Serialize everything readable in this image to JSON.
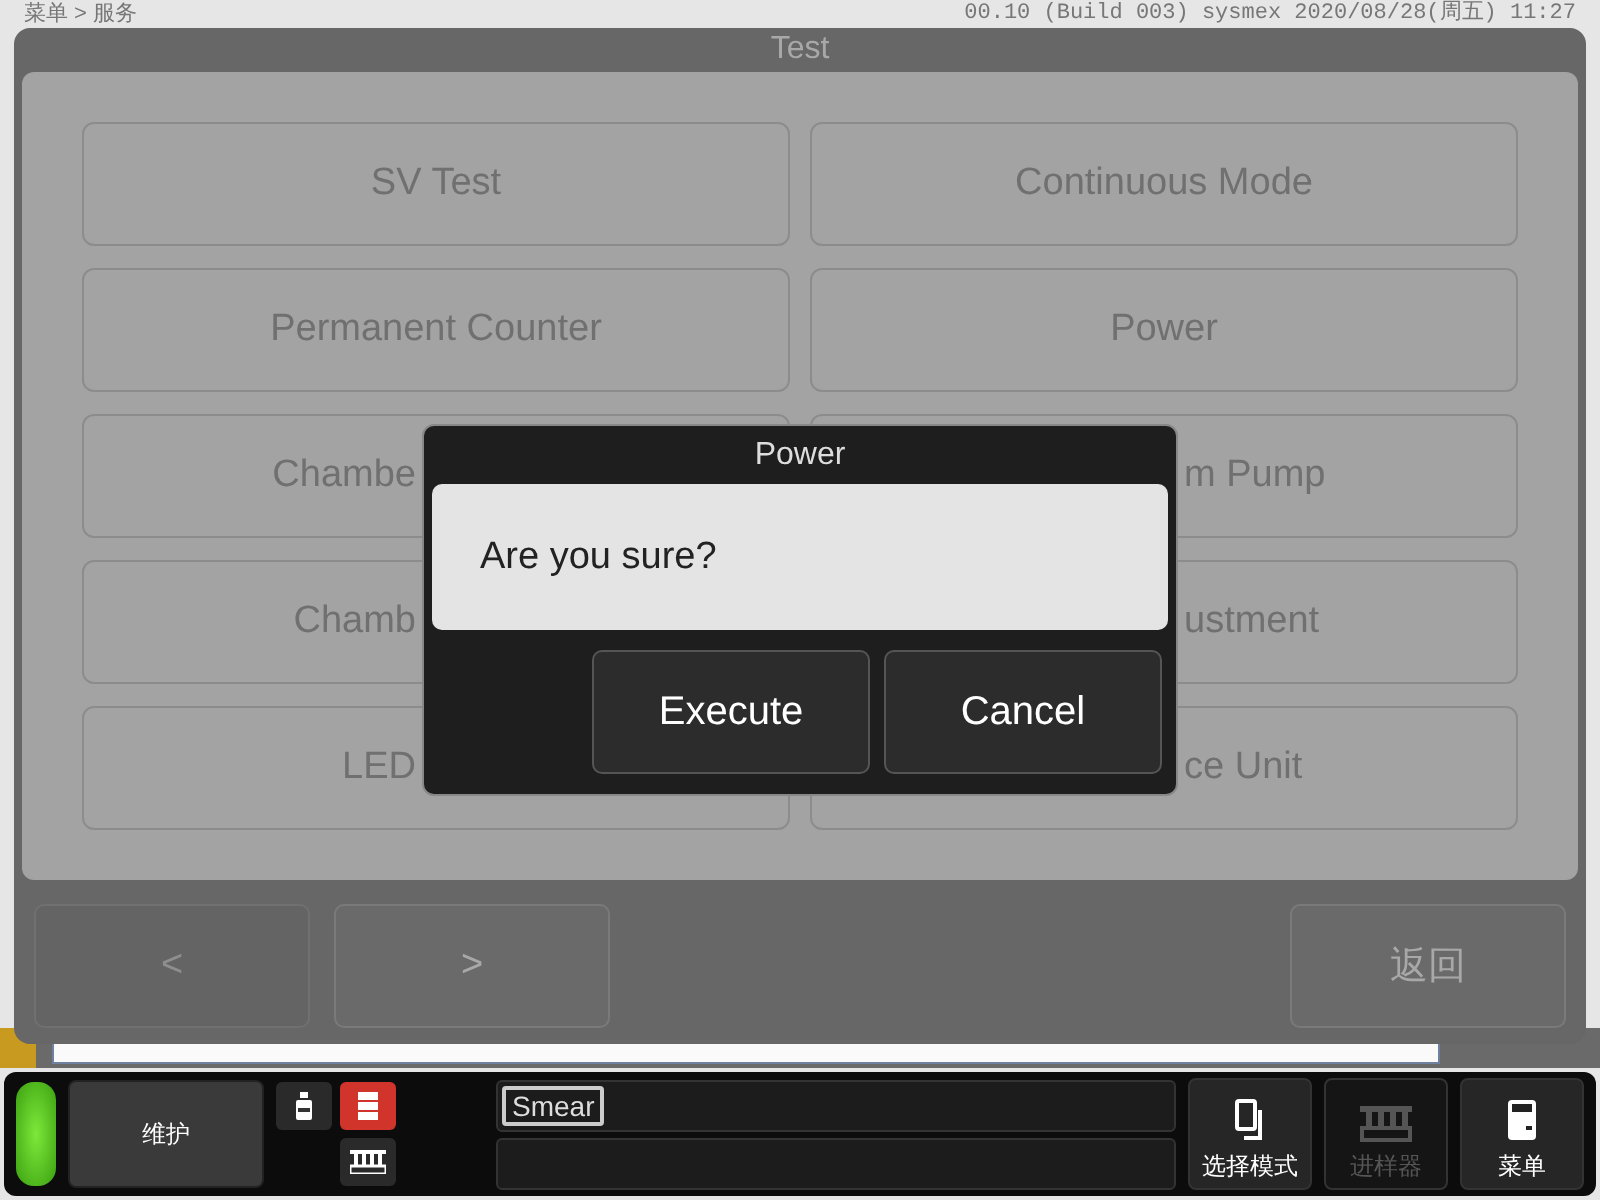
{
  "header": {
    "breadcrumb": "菜单 > 服务",
    "info": "00.10 (Build 003) sysmex 2020/08/28(周五) 11:27"
  },
  "panel": {
    "title": "Test",
    "buttons": [
      {
        "label": "SV Test",
        "kind": "full"
      },
      {
        "label": "Continuous Mode",
        "kind": "full"
      },
      {
        "label": "Permanent Counter",
        "kind": "full"
      },
      {
        "label": "Power",
        "kind": "full"
      },
      {
        "label": "Chambe",
        "kind": "cut_right"
      },
      {
        "label": "m Pump",
        "kind": "cut_left"
      },
      {
        "label": "Chamb",
        "kind": "cut_right"
      },
      {
        "label": "ustment",
        "kind": "cut_left"
      },
      {
        "label": "LED",
        "kind": "cut_right"
      },
      {
        "label": "ce Unit",
        "kind": "cut_left"
      }
    ],
    "nav": [
      {
        "label": "<",
        "disabled": true
      },
      {
        "label": ">",
        "disabled": false
      }
    ],
    "back": "返回"
  },
  "dialog": {
    "title": "Power",
    "message": "Are you sure?",
    "buttons": [
      "Execute",
      "Cancel"
    ]
  },
  "status_bar": {
    "led_on": true,
    "maintenance": "维护",
    "icons": [
      {
        "kind": "bottle",
        "selected": false
      },
      {
        "kind": "cabinet",
        "selected": true
      },
      {
        "kind": "rack",
        "selected": false
      }
    ],
    "mode_tag": "Smear",
    "actions": [
      {
        "label": "选择模式",
        "kind": "mode",
        "disabled": false
      },
      {
        "label": "进样器",
        "kind": "rack",
        "disabled": true
      },
      {
        "label": "菜单",
        "kind": "menu",
        "disabled": false
      }
    ]
  }
}
